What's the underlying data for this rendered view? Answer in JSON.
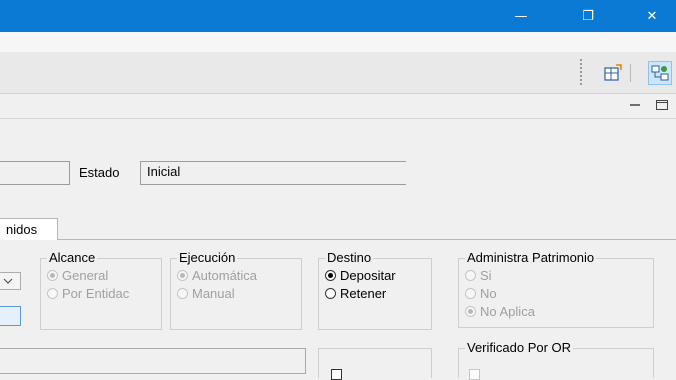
{
  "window": {
    "minimize_glyph": "—",
    "restore_glyph": "❐",
    "close_glyph": "✕",
    "titlebar_color": "#0a7ad4"
  },
  "toolbar": {
    "icons": [
      "new-window-icon",
      "network-view-icon"
    ]
  },
  "form": {
    "estado_label": "Estado",
    "estado_value": "Inicial"
  },
  "tabs": {
    "active_partial": "nidos"
  },
  "groups": {
    "alcance": {
      "title": "Alcance",
      "options": [
        "General",
        "Por Entidac"
      ],
      "selected": "General",
      "enabled": false
    },
    "ejecucion": {
      "title": "Ejecución",
      "options": [
        "Automática",
        "Manual"
      ],
      "selected": "Automática",
      "enabled": false
    },
    "destino": {
      "title": "Destino",
      "options": [
        "Depositar",
        "Retener"
      ],
      "selected": "Depositar",
      "enabled": true
    },
    "administra": {
      "title": "Administra Patrimonio",
      "options": [
        "Si",
        "No",
        "No Aplica"
      ],
      "selected": "No Aplica",
      "enabled": false
    },
    "verificado": {
      "title": "Verificado Por OR"
    }
  }
}
